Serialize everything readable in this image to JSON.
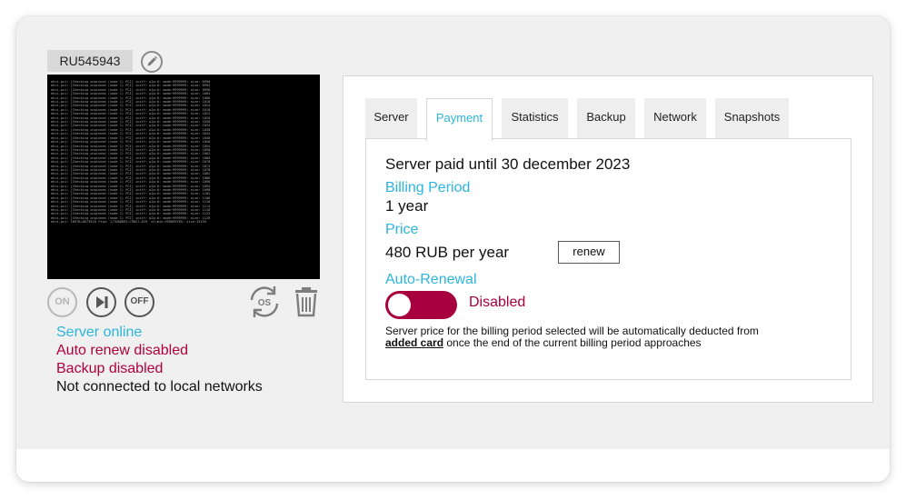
{
  "server": {
    "id": "RU545943"
  },
  "console_lines": [
    "ehci-pci: [Checking unpinned (node 1) PCI] initf: p2p:0: mode:9999999: size: 0990",
    "ehci-pci: [Checking unpinned (node 1) PCI] initf: p2p:0: mode:9999999: size: 0994",
    "ehci-pci: [Checking unpinned (node 1) PCI] initf: p2p:0: mode:9999999: size: 0998",
    "ehci-pci: [Checking unpinned (node 1) PCI] initf: p2p:0: mode:9999999: size: 1002",
    "ehci-pci: [Checking unpinned (node 1) PCI] initf: p2p:0: mode:9999999: size: 1006",
    "ehci-pci: [Checking unpinned (node 1) PCI] initf: p2p:0: mode:9999999: size: 1010",
    "ehci-pci: [Checking unpinned (node 1) PCI] initf: p2p:0: mode:9999999: size: 1014",
    "ehci-pci: [Checking unpinned (node 1) PCI] initf: p2p:0: mode:9999999: size: 1018",
    "ehci-pci: [Checking unpinned (node 1) PCI] initf: p2p:0: mode:9999999: size: 1022",
    "ehci-pci: [Checking unpinned (node 1) PCI] initf: p2p:0: mode:9999999: size: 1026",
    "ehci-pci: [Checking unpinned (node 1) PCI] initf: p2p:0: mode:9999999: size: 1030",
    "ehci-pci: [Checking unpinned (node 1) PCI] initf: p2p:0: mode:9999999: size: 1034",
    "ehci-pci: [Checking unpinned (node 1) PCI] initf: p2p:0: mode:9999999: size: 1038",
    "ehci-pci: [Checking unpinned (node 1) PCI] initf: p2p:0: mode:9999999: size: 1042",
    "ehci-pci: [Checking unpinned (node 1) PCI] initf: p2p:0: mode:9999999: size: 1046",
    "ehci-pci: [Checking unpinned (node 1) PCI] initf: p2p:0: mode:9999999: size: 1050",
    "ehci-pci: [Checking unpinned (node 1) PCI] initf: p2p:0: mode:9999999: size: 1054",
    "ehci-pci: [Checking unpinned (node 1) PCI] initf: p2p:0: mode:9999999: size: 1058",
    "ehci-pci: [Checking unpinned (node 1) PCI] initf: p2p:0: mode:9999999: size: 1062",
    "ehci-pci: [Checking unpinned (node 1) PCI] initf: p2p:0: mode:9999999: size: 1066",
    "ehci-pci: [Checking unpinned (node 1) PCI] initf: p2p:0: mode:9999999: size: 1070",
    "ehci-pci: [Checking unpinned (node 1) PCI] initf: p2p:0: mode:9999999: size: 1074",
    "ehci-pci: [Checking unpinned (node 1) PCI] initf: p2p:0: mode:9999999: size: 1078",
    "ehci-pci: [Checking unpinned (node 1) PCI] initf: p2p:0: mode:9999999: size: 1082",
    "ehci-pci: [Checking unpinned (node 1) PCI] initf: p2p:0: mode:9999999: size: 1086",
    "ehci-pci: [Checking unpinned (node 1) PCI] initf: p2p:0: mode:9999999: size: 1090",
    "ehci-pci: [Checking unpinned (node 1) PCI] initf: p2p:0: mode:9999999: size: 1094",
    "ehci-pci: [Checking unpinned (node 1) PCI] initf: p2p:0: mode:9999999: size: 1098",
    "ehci-pci: [Checking unpinned (node 1) PCI] initf: p2p:0: mode:9999999: size: 1102",
    "ehci-pci: [Checking unpinned (node 1) PCI] initf: p2p:0: mode:9999999: size: 1106",
    "ehci-pci: [Checking unpinned (node 1) PCI] initf: p2p:0: mode:9999999: size: 1110",
    "ehci-pci: [Checking unpinned (node 1) PCI] initf: p2p:0: mode:9999999: size: 1114",
    "ehci-pci: [Checking unpinned (node 1) PCI] initf: p2p:0: mode:9999999: size: 1118",
    "ehci-pci: [Checking unpinned (node 1) PCI] initf: p2p:0: mode:9999999: size: 1122",
    "ehci-pci: [Checking unpinned (node 1) PCI] initf: p2p:0: mode:9999999: size: 1126",
    "ehci-pci: 1897B+6073910 ftim: 1/7000093:C9627-019. bl/min:999899765: size:19159"
  ],
  "controls": {
    "on_label": "ON",
    "off_label": "OFF",
    "os_label": "OS"
  },
  "status": {
    "online": "Server online",
    "auto_renew": "Auto renew disabled",
    "backup": "Backup disabled",
    "network": "Not connected to local networks"
  },
  "tabs": [
    {
      "label": "Server"
    },
    {
      "label": "Payment"
    },
    {
      "label": "Statistics"
    },
    {
      "label": "Backup"
    },
    {
      "label": "Network"
    },
    {
      "label": "Snapshots"
    }
  ],
  "active_tab": "Payment",
  "payment": {
    "paid_until": "Server paid until 30 december 2023",
    "billing_period_label": "Billing Period",
    "billing_period_value": "1 year",
    "price_label": "Price",
    "price_value": "480 RUB per year",
    "renew_button": "renew",
    "auto_renewal_label": "Auto-Renewal",
    "auto_renewal_state": "Disabled",
    "note_before": "Server price for the billing period selected will be automatically deducted from ",
    "note_link": "added card",
    "note_after": " once the end of the current billing period approaches"
  },
  "colors": {
    "accent_blue": "#2cb5dd",
    "alert_crimson": "#b0003e",
    "toggle_off": "#a8003e"
  }
}
